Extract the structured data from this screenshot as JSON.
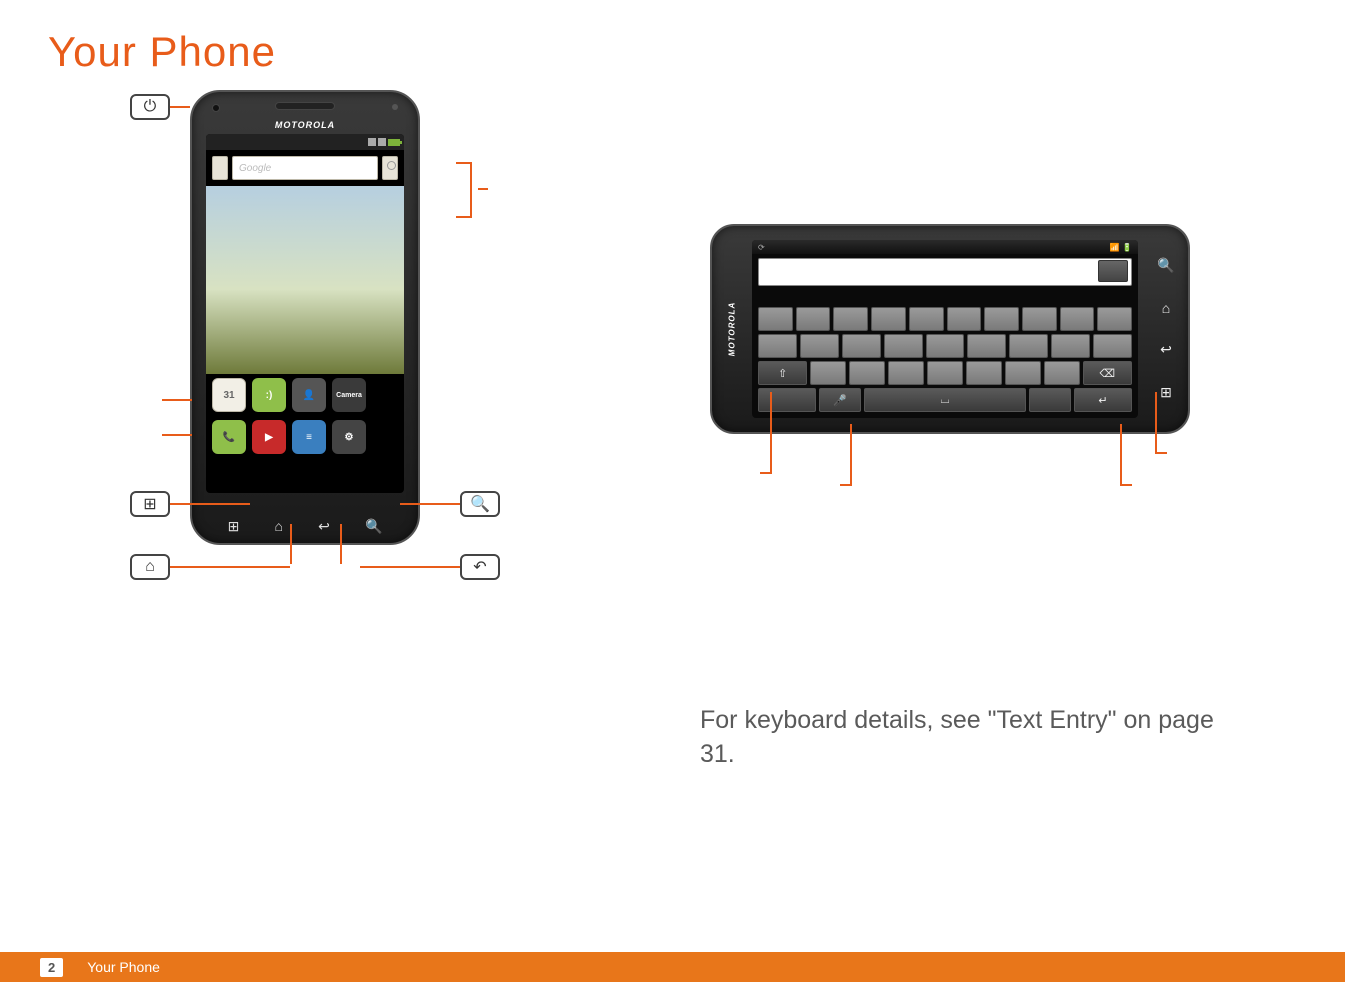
{
  "page_title": "Your Phone",
  "footer_page_number": "2",
  "footer_section": "Your Phone",
  "body_text": "For keyboard details, see \"Text Entry\" on page 31.",
  "brand": "MOTOROLA",
  "search_placeholder": "Google",
  "calendar_icon_label": "31",
  "camera_icon_label": "Camera",
  "chart_data": {}
}
